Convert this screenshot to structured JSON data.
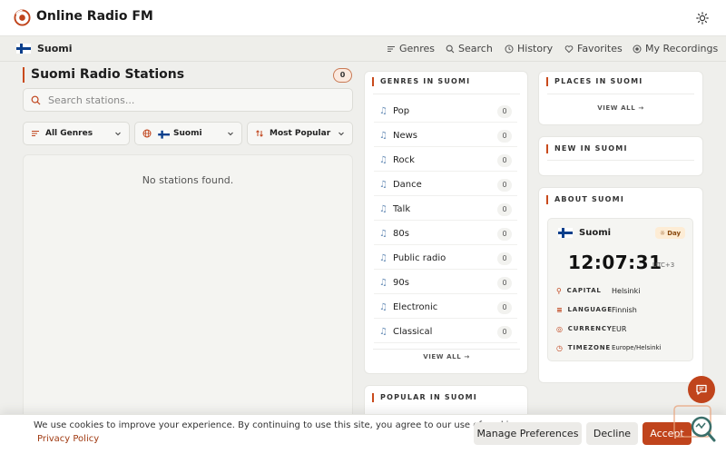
{
  "app": {
    "title": "Online Radio FM"
  },
  "nav": {
    "country": "Suomi",
    "links": [
      {
        "label": "Genres",
        "icon": "genres-icon"
      },
      {
        "label": "Search",
        "icon": "search-icon"
      },
      {
        "label": "History",
        "icon": "history-icon"
      },
      {
        "label": "Favorites",
        "icon": "heart-icon"
      },
      {
        "label": "My Recordings",
        "icon": "record-icon"
      }
    ]
  },
  "stations": {
    "title": "Suomi Radio Stations",
    "count": "0",
    "search_placeholder": "Search stations...",
    "filters": {
      "genre": "All Genres",
      "country": "Suomi",
      "sort": "Most Popular"
    },
    "empty_message": "No stations found."
  },
  "genres": {
    "title": "GENRES IN SUOMI",
    "items": [
      {
        "label": "Pop",
        "count": "0"
      },
      {
        "label": "News",
        "count": "0"
      },
      {
        "label": "Rock",
        "count": "0"
      },
      {
        "label": "Dance",
        "count": "0"
      },
      {
        "label": "Talk",
        "count": "0"
      },
      {
        "label": "80s",
        "count": "0"
      },
      {
        "label": "Public radio",
        "count": "0"
      },
      {
        "label": "90s",
        "count": "0"
      },
      {
        "label": "Electronic",
        "count": "0"
      },
      {
        "label": "Classical",
        "count": "0"
      }
    ],
    "view_all": "VIEW ALL →"
  },
  "popular": {
    "title": "POPULAR IN SUOMI"
  },
  "places": {
    "title": "PLACES IN SUOMI",
    "view_all": "VIEW ALL →"
  },
  "new_in": {
    "title": "NEW IN SUOMI"
  },
  "about": {
    "title": "ABOUT SUOMI",
    "country": "Suomi",
    "day_label": "Day",
    "time": "12:07:31",
    "utc": "UTC+3",
    "rows": [
      {
        "label": "CAPITAL",
        "value": "Helsinki",
        "icon": "pin-icon"
      },
      {
        "label": "LANGUAGE",
        "value": "Finnish",
        "icon": "language-icon"
      },
      {
        "label": "CURRENCY",
        "value": "EUR",
        "icon": "currency-icon"
      },
      {
        "label": "TIMEZONE",
        "value": "Europe/Helsinki",
        "icon": "clock-icon"
      }
    ]
  },
  "cookie": {
    "message": "We use cookies to improve your experience. By continuing to use this site, you agree to our use of cookies.",
    "policy_link": "Privacy Policy",
    "manage": "Manage Preferences",
    "decline": "Decline",
    "accept": "Accept"
  },
  "colors": {
    "accent": "#c0441c",
    "background": "#efefec",
    "finland_blue": "#0b3f8c"
  }
}
